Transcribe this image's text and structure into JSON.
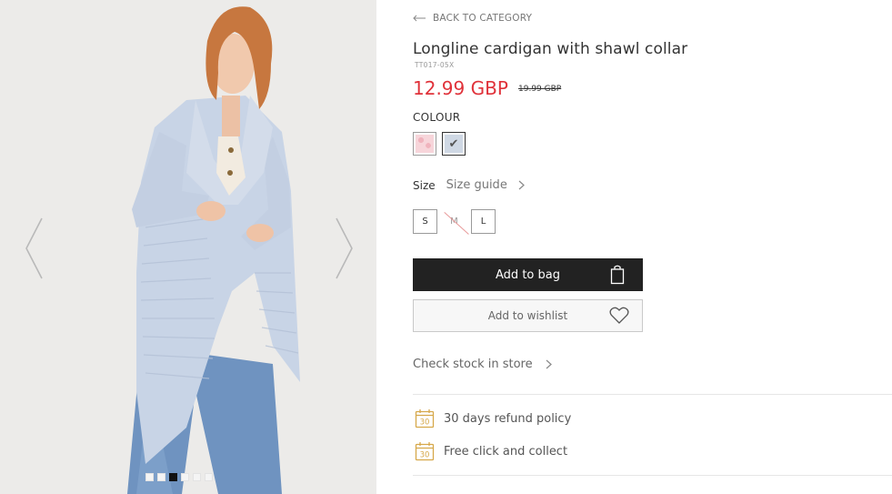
{
  "gallery": {
    "prev_icon": "chevron-left-icon",
    "next_icon": "chevron-right-icon",
    "dots_count": 6,
    "active_dot": 3
  },
  "nav": {
    "back_label": "BACK TO CATEGORY",
    "back_icon": "arrow-left-icon"
  },
  "product": {
    "title": "Longline cardigan with shawl collar",
    "sku": "TT017-05X",
    "price": "12.99 GBP",
    "old_price": "19.99 GBP",
    "price_color": "#e0323a"
  },
  "colour": {
    "label": "COLOUR",
    "swatches": [
      {
        "name": "pink",
        "selected": false
      },
      {
        "name": "light-blue",
        "selected": true,
        "mark": "✔"
      }
    ]
  },
  "size": {
    "label": "Size",
    "guide_label": "Size guide",
    "options": [
      {
        "label": "S",
        "available": true
      },
      {
        "label": "M",
        "available": false
      },
      {
        "label": "L",
        "available": true
      }
    ]
  },
  "actions": {
    "add_to_bag": "Add to bag",
    "add_to_bag_icon": "shopping-bag-icon",
    "wishlist": "Add to wishlist",
    "wishlist_icon": "heart-icon",
    "check_stock": "Check stock in store"
  },
  "features": [
    {
      "icon": "calendar-30-icon",
      "icon_text": "30",
      "label": "30 days refund policy"
    },
    {
      "icon": "calendar-30-icon",
      "icon_text": "30",
      "label": "Free click and collect"
    }
  ],
  "colors": {
    "accent": "#e0323a",
    "button_dark": "#222222",
    "icon_gold": "#d6a84a"
  }
}
